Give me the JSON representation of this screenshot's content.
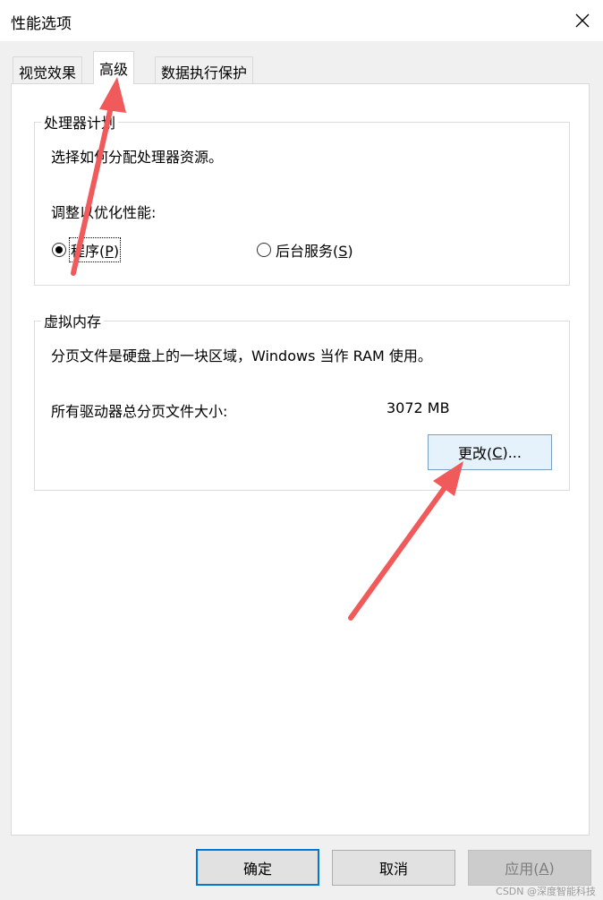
{
  "window": {
    "title": "性能选项"
  },
  "tabs": [
    {
      "label": "视觉效果"
    },
    {
      "label": "高级"
    },
    {
      "label": "数据执行保护"
    }
  ],
  "processor": {
    "legend": "处理器计划",
    "description": "选择如何分配处理器资源。",
    "adjust_label": "调整以优化性能:",
    "option_programs": {
      "text": "程序(",
      "key": "P",
      "tail": ")",
      "checked": true
    },
    "option_services": {
      "text": "后台服务(",
      "key": "S",
      "tail": ")",
      "checked": false
    }
  },
  "virtual_memory": {
    "legend": "虚拟内存",
    "description": "分页文件是硬盘上的一块区域，Windows 当作 RAM 使用。",
    "total_label": "所有驱动器总分页文件大小:",
    "total_value": "3072 MB",
    "change_button": {
      "text": "更改(",
      "key": "C",
      "tail": ")..."
    }
  },
  "footer": {
    "ok": "确定",
    "cancel": "取消",
    "apply": {
      "text": "应用(",
      "key": "A",
      "tail": ")"
    }
  },
  "watermark": "CSDN @深度智能科技",
  "colors": {
    "accent": "#0078d7",
    "annotation_arrow": "#f05a5a"
  },
  "icons": {
    "close": "close-icon"
  }
}
